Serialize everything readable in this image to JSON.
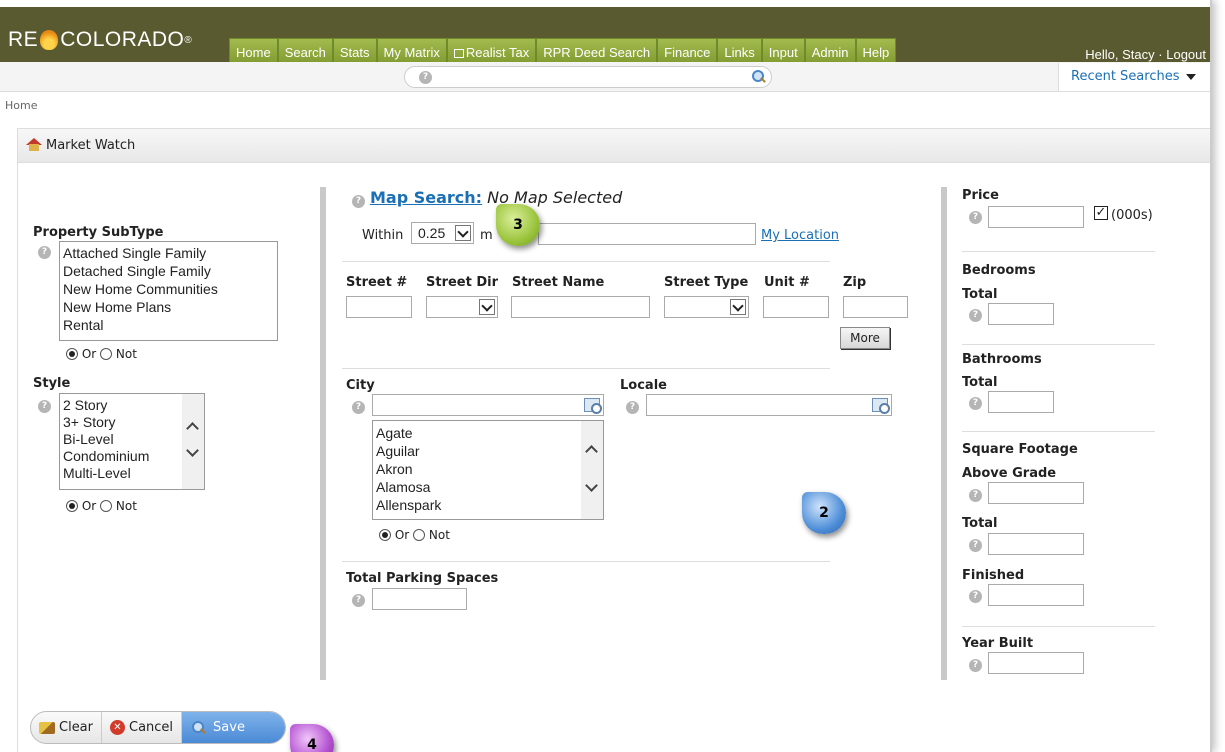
{
  "header": {
    "logo_left": "RE",
    "logo_right": "COLORADO",
    "logo_mark": "®",
    "nav": [
      "Home",
      "Search",
      "Stats",
      "My Matrix",
      "Realist Tax",
      "RPR Deed Search",
      "Finance",
      "Links",
      "Input",
      "Admin",
      "Help"
    ],
    "greeting": "Hello, Stacy",
    "separator": "·",
    "logout": "Logout"
  },
  "search_bar": {
    "help": "?",
    "recent": "Recent Searches"
  },
  "breadcrumb": "Home",
  "panel": {
    "title": "Market Watch"
  },
  "left": {
    "subtype_label": "Property SubType",
    "subtype_options": [
      "Attached Single Family",
      "Detached Single Family",
      "New Home Communities",
      "New Home Plans",
      "Rental"
    ],
    "style_label": "Style",
    "style_options": [
      "2 Story",
      "3+ Story",
      "Bi-Level",
      "Condominium",
      "Multi-Level"
    ],
    "or": "Or",
    "not": "Not"
  },
  "middle": {
    "map_search": "Map Search:",
    "no_map": "No Map Selected",
    "within": "Within",
    "within_value": "0.25",
    "mi_partial": "m",
    "my_location": "My Location",
    "street_num": "Street #",
    "street_dir": "Street Dir",
    "street_name": "Street Name",
    "street_type": "Street Type",
    "unit": "Unit #",
    "zip": "Zip",
    "more": "More",
    "city": "City",
    "locale": "Locale",
    "cities": [
      "Agate",
      "Aguilar",
      "Akron",
      "Alamosa",
      "Allenspark"
    ],
    "or": "Or",
    "not": "Not",
    "parking": "Total Parking Spaces"
  },
  "right": {
    "price": "Price",
    "thousands": "(000s)",
    "bedrooms": "Bedrooms",
    "bed_total": "Total",
    "bathrooms": "Bathrooms",
    "bath_total": "Total",
    "sqft": "Square Footage",
    "above_grade": "Above Grade",
    "sqft_total": "Total",
    "finished": "Finished",
    "year_built": "Year Built"
  },
  "callouts": {
    "c2": "2",
    "c3": "3",
    "c4": "4"
  },
  "toolbar": {
    "clear": "Clear",
    "cancel": "Cancel",
    "save": "Save"
  },
  "colors": {
    "topbar": "#5a5a31",
    "nav": "#8fa83c",
    "link": "#1a6fb5",
    "callout_green": "#9bc43d",
    "callout_blue": "#4f8fd8",
    "callout_purple": "#b24fcf"
  }
}
